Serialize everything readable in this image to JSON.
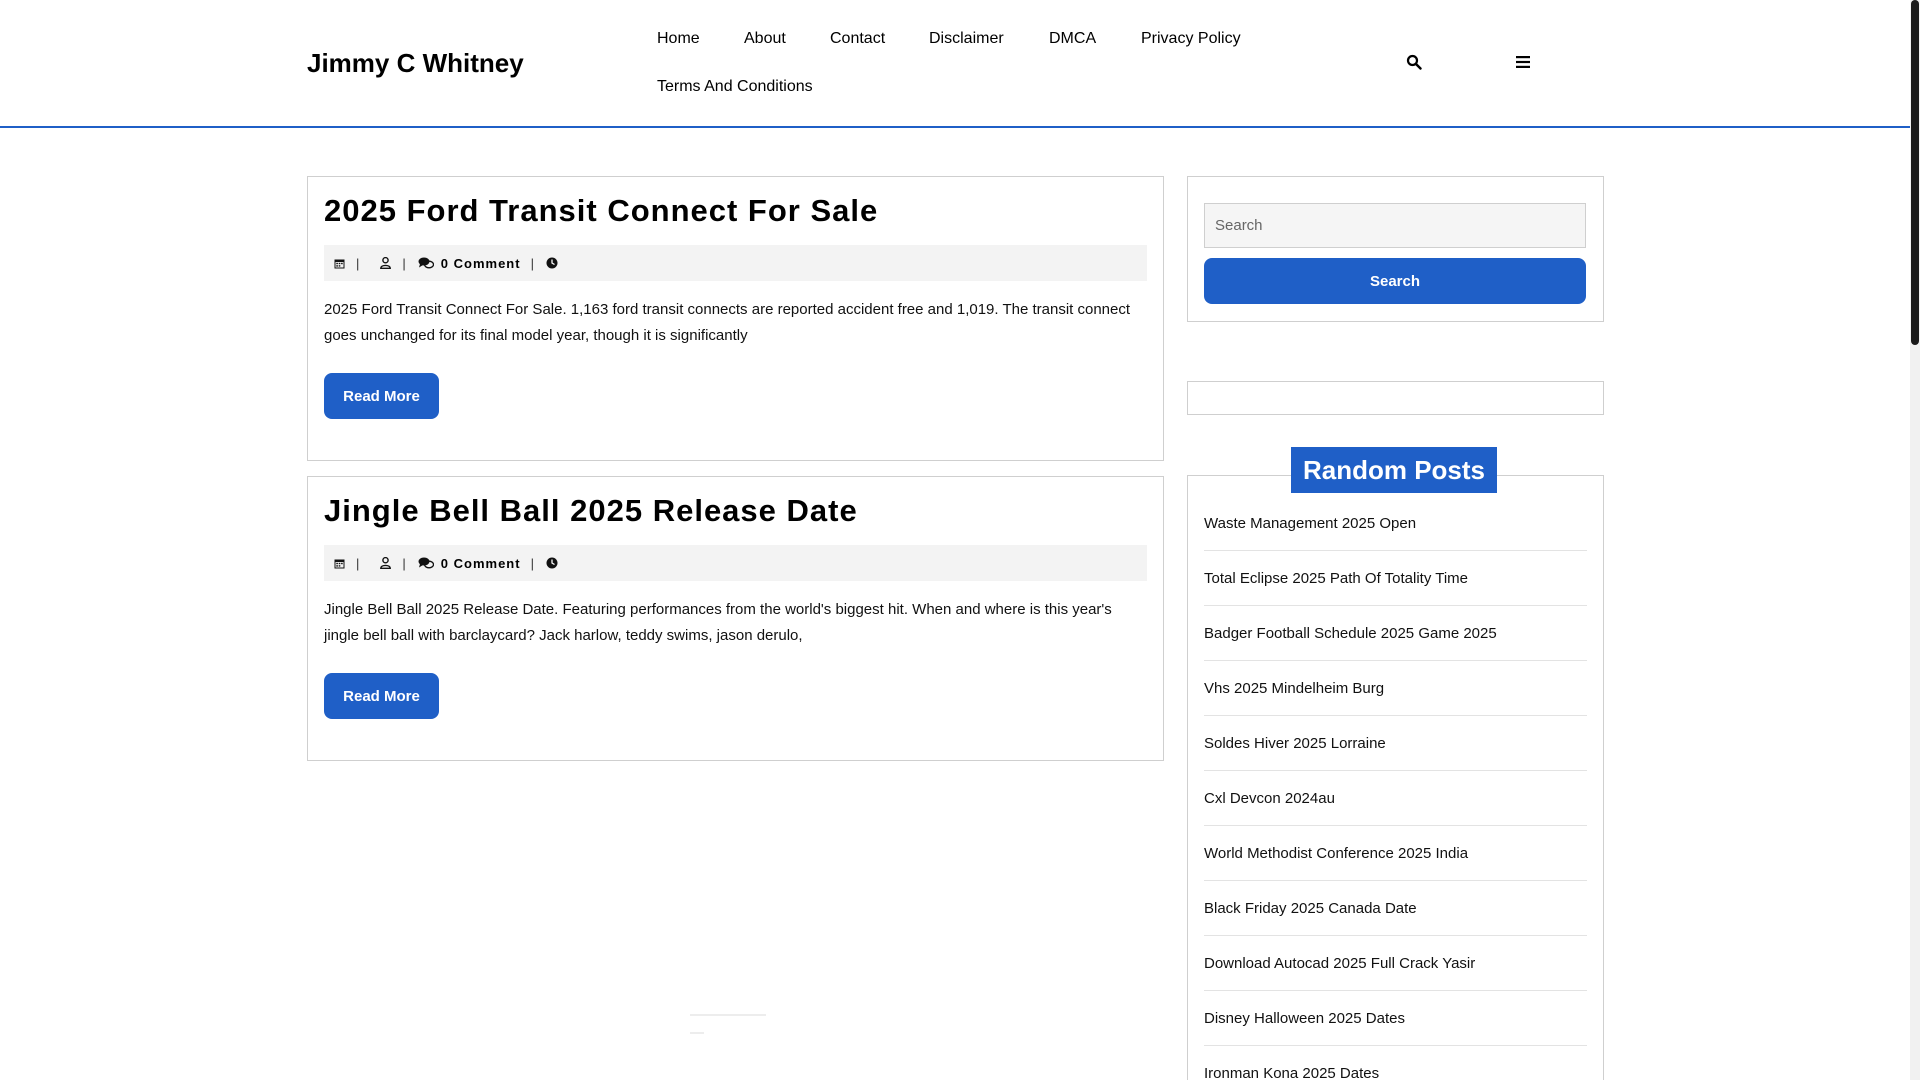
{
  "site": {
    "title": "Jimmy C Whitney"
  },
  "nav": [
    {
      "label": "Home"
    },
    {
      "label": "About"
    },
    {
      "label": "Contact"
    },
    {
      "label": "Disclaimer"
    },
    {
      "label": "DMCA"
    },
    {
      "label": "Privacy Policy"
    },
    {
      "label": "Terms And Conditions"
    }
  ],
  "header_icons": {
    "search": "search-icon",
    "menu": "hamburger-menu-icon"
  },
  "posts": [
    {
      "title": "2025 Ford Transit Connect For Sale",
      "comments": "0 Comment",
      "excerpt": "2025 Ford Transit Connect For Sale. 1,163 ford transit connects are reported accident free and 1,019. The transit connect goes unchanged for its final model year, though it is significantly",
      "button": "Read More"
    },
    {
      "title": "Jingle Bell Ball 2025 Release Date",
      "comments": "0 Comment",
      "excerpt": "Jingle Bell Ball 2025 Release Date. Featuring performances from the world's biggest hit. When and where is this year's jingle bell ball with barclaycard? Jack harlow, teddy swims, jason derulo,",
      "button": "Read More"
    }
  ],
  "meta_icons": [
    "calendar-icon",
    "user-icon",
    "comments-icon",
    "clock-icon"
  ],
  "sidebar": {
    "search": {
      "placeholder": "Search",
      "button": "Search"
    },
    "random_posts": {
      "title": "Random Posts",
      "items": [
        "Waste Management 2025 Open",
        "Total Eclipse 2025 Path Of Totality Time",
        "Badger Football Schedule 2025 Game 2025",
        "Vhs 2025 Mindelheim Burg",
        "Soldes Hiver 2025 Lorraine",
        "Cxl Devcon 2024au",
        "World Methodist Conference 2025 India",
        "Black Friday 2025 Canada Date",
        "Download Autocad 2025 Full Crack Yasir",
        "Disney Halloween 2025 Dates",
        "Ironman Kona 2025 Dates"
      ]
    }
  },
  "colors": {
    "accent": "#1f5fc7",
    "border": "#cfcfcf",
    "meta_bg": "#f3f3f3"
  }
}
